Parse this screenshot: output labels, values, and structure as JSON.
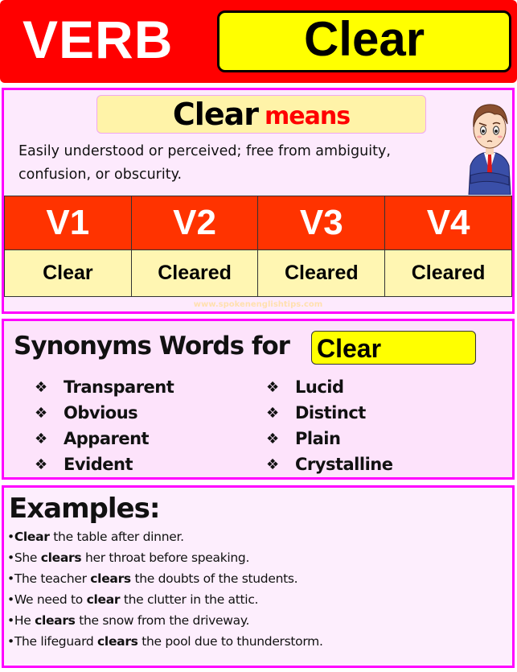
{
  "header": {
    "label": "VERB",
    "word": "Clear"
  },
  "meaning": {
    "word": "Clear",
    "means_label": "means",
    "definition": "Easily understood or perceived; free from ambiguity, confusion, or obscurity.",
    "character_icon": "confused-man-illustration"
  },
  "forms": {
    "headers": [
      "V1",
      "V2",
      "V3",
      "V4"
    ],
    "values": [
      "Clear",
      "Cleared",
      "Cleared",
      "Cleared"
    ]
  },
  "watermark": "www.spokenenglishtips.com",
  "synonyms": {
    "title": "Synonyms Words for",
    "word": "Clear",
    "bullet_icon": "diamond-bullet",
    "left": [
      "Transparent",
      "Obvious",
      "Apparent",
      "Evident"
    ],
    "right": [
      "Lucid",
      "Distinct",
      "Plain",
      "Crystalline"
    ]
  },
  "examples": {
    "title": "Examples:",
    "items": [
      {
        "before": "",
        "bold": "Clear",
        "after": " the table after dinner."
      },
      {
        "before": "She ",
        "bold": "clears",
        "after": " her throat before speaking."
      },
      {
        "before": "The teacher ",
        "bold": "clears",
        "after": " the doubts of the students."
      },
      {
        "before": "We need to ",
        "bold": "clear",
        "after": " the clutter in the attic."
      },
      {
        "before": "He ",
        "bold": "clears",
        "after": " the snow from the driveway."
      },
      {
        "before": "The lifeguard ",
        "bold": "clears",
        "after": " the pool due to thunderstorm."
      }
    ]
  },
  "colors": {
    "header_red": "#ff0000",
    "word_yellow": "#ffff00",
    "frame_magenta": "#ff00ff",
    "table_head": "#ff3300",
    "table_body": "#fff6b2",
    "means_red": "#ff0000"
  }
}
